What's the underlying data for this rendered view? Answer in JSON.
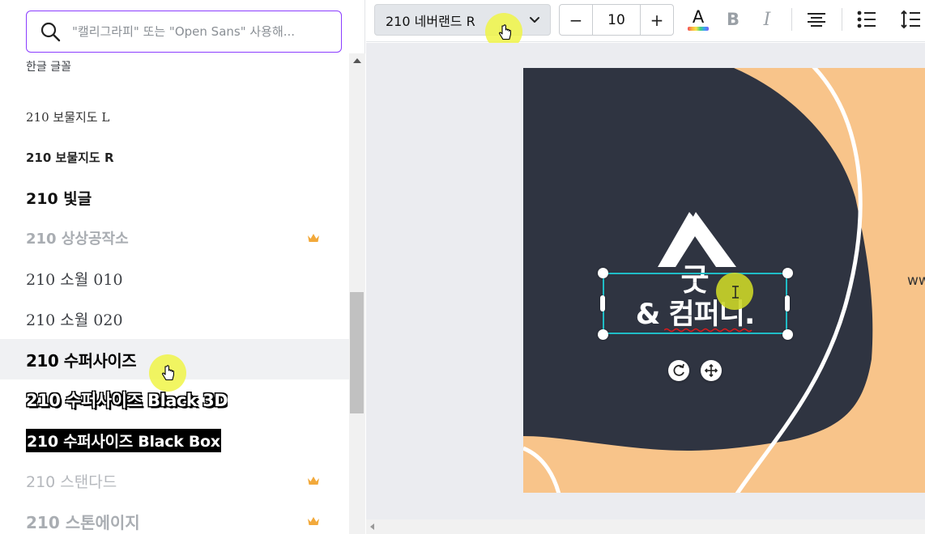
{
  "search": {
    "placeholder": "\"캘리그라피\" 또는 \"Open Sans\" 사용해..."
  },
  "font_panel": {
    "section_heading": "한글 글꼴",
    "fonts": [
      {
        "label": "210 보물지도 L",
        "premium": false
      },
      {
        "label": "210 보물지도 R",
        "premium": false
      },
      {
        "label": "210 빛글",
        "premium": false
      },
      {
        "label": "210 상상공작소",
        "premium": true
      },
      {
        "label": "210 소월 010",
        "premium": false
      },
      {
        "label": "210 소월 020",
        "premium": false
      },
      {
        "label": "210 수퍼사이즈",
        "premium": false
      },
      {
        "label": "210 수퍼사이즈 Black 3D",
        "premium": false
      },
      {
        "label": "210 수퍼사이즈 Black Box",
        "premium": false
      },
      {
        "label": "210 스탠다드",
        "premium": true
      },
      {
        "label": "210 스톤에이지",
        "premium": true
      }
    ],
    "hovered_index": 6
  },
  "toolbar": {
    "font_selector_label": "210 네버랜드 R",
    "font_size": "10",
    "decrease_label": "−",
    "increase_label": "+",
    "text_color_letter": "A",
    "bold_label": "B",
    "italic_label": "I"
  },
  "canvas": {
    "headline_line1": "굿",
    "headline_line2": "& 컴퍼니.",
    "side_text": "ww",
    "colors": {
      "background_dark": "#2f3441",
      "accent_peach": "#f8c48a",
      "selection": "#1fbcc6"
    }
  },
  "colors": {
    "search_border": "#8b3dff",
    "crown": "#f2a93b",
    "cursor_highlight": "#f0f546"
  },
  "icons": [
    "search-icon",
    "crown-icon",
    "chevron-down-icon",
    "align-center-icon",
    "bulleted-list-icon",
    "line-spacing-icon",
    "rotate-icon",
    "move-icon",
    "hand-cursor-icon",
    "text-cursor-icon"
  ]
}
